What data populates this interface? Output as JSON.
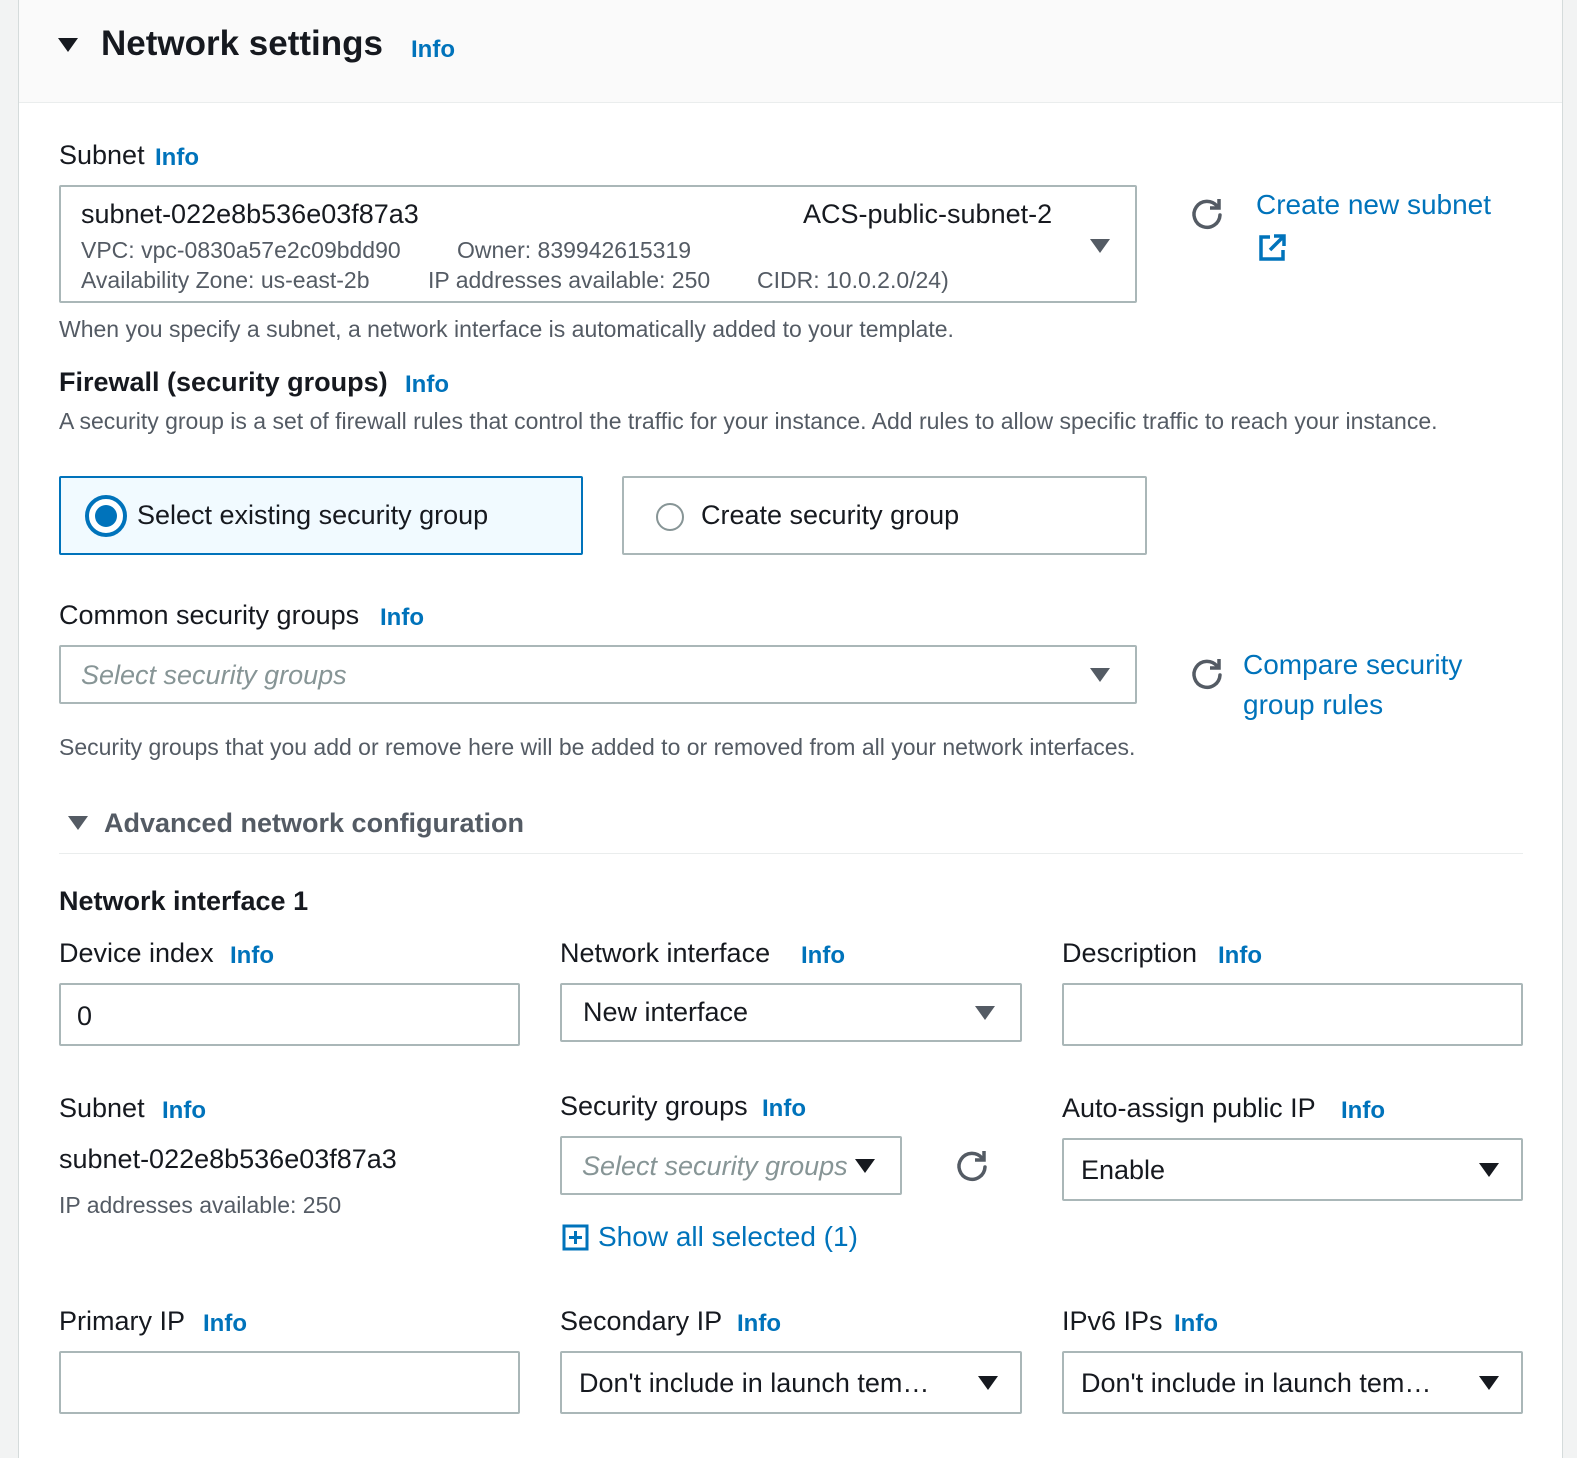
{
  "section": {
    "title": "Network settings",
    "info": "Info"
  },
  "subnet": {
    "label": "Subnet",
    "info": "Info",
    "selected_id": "subnet-022e8b536e03f87a3",
    "selected_name": "ACS-public-subnet-2",
    "vpc": "VPC: vpc-0830a57e2c09bdd90",
    "owner": "Owner: 839942615319",
    "az": "Availability Zone: us-east-2b",
    "ips": "IP addresses available: 250",
    "cidr": "CIDR: 10.0.2.0/24)",
    "create_link": "Create new subnet",
    "hint": "When you specify a subnet, a network interface is automatically added to your template."
  },
  "firewall": {
    "label": "Firewall (security groups)",
    "info": "Info",
    "description": "A security group is a set of firewall rules that control the traffic for your instance. Add rules to allow specific traffic to reach your instance.",
    "option_existing": "Select existing security group",
    "option_create": "Create security group"
  },
  "common_sg": {
    "label": "Common security groups",
    "info": "Info",
    "placeholder": "Select security groups",
    "compare_link_line1": "Compare security",
    "compare_link_line2": "group rules",
    "hint": "Security groups that you add or remove here will be added to or removed from all your network interfaces."
  },
  "advanced": {
    "title": "Advanced network configuration"
  },
  "interface": {
    "title": "Network interface 1",
    "device_index": {
      "label": "Device index",
      "info": "Info",
      "value": "0"
    },
    "network_interface": {
      "label": "Network interface",
      "info": "Info",
      "value": "New interface"
    },
    "description": {
      "label": "Description",
      "info": "Info",
      "value": ""
    },
    "subnet": {
      "label": "Subnet",
      "info": "Info",
      "value": "subnet-022e8b536e03f87a3",
      "ips": "IP addresses available: 250"
    },
    "security_groups": {
      "label": "Security groups",
      "info": "Info",
      "placeholder": "Select security groups",
      "show_all": "Show all selected (1)"
    },
    "auto_assign": {
      "label": "Auto-assign public IP",
      "info": "Info",
      "value": "Enable"
    },
    "primary_ip": {
      "label": "Primary IP",
      "info": "Info",
      "value": ""
    },
    "secondary_ip": {
      "label": "Secondary IP",
      "info": "Info",
      "value": "Don't include in launch tem…"
    },
    "ipv6": {
      "label": "IPv6 IPs",
      "info": "Info",
      "value": "Don't include in launch tem…"
    }
  },
  "colors": {
    "link": "#0073bb",
    "border": "#aab7b8",
    "selected_bg": "#f1faff",
    "text": "#16191f",
    "muted": "#545b64"
  }
}
